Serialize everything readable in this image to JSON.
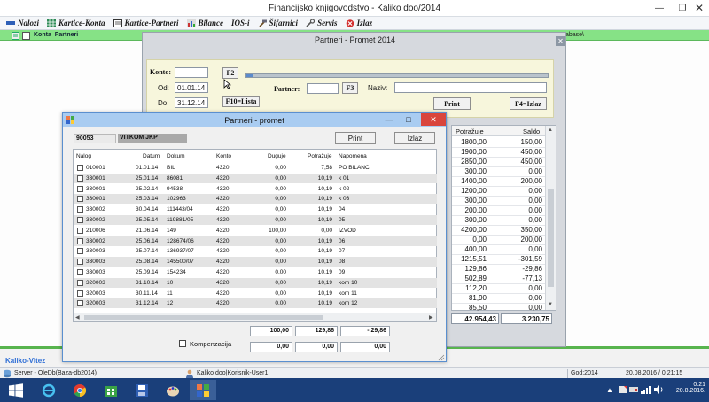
{
  "window": {
    "title": "Financijsko knjigovodstvo - Kaliko doo/2014"
  },
  "menu": [
    {
      "label": "Nalozi",
      "icon": "document-icon"
    },
    {
      "label": "Kartice-Konta",
      "icon": "grid-icon"
    },
    {
      "label": "Kartice-Partneri",
      "icon": "card-icon"
    },
    {
      "label": "Bilance",
      "icon": "chart-icon"
    },
    {
      "label": "IOS-i",
      "icon": ""
    },
    {
      "label": "Šifarnici",
      "icon": "hammer-icon"
    },
    {
      "label": "Servis",
      "icon": "wrench-icon"
    },
    {
      "label": "Izlaz",
      "icon": "exit-icon"
    }
  ],
  "tabs": {
    "konta": "Konta",
    "partneri": "Partneri"
  },
  "green_right": "tabase\\",
  "partneri_promet_window": {
    "title": "Partneri - Promet 2014",
    "konto_label": "Konto:",
    "konto_value": "",
    "f2_button": "F2",
    "od_label": "Od:",
    "od_value": "01.01.14",
    "do_label": "Do:",
    "do_value": "31.12.14",
    "f10_button": "F10=Lista",
    "partner_label": "Partner:",
    "partner_value": "",
    "f3_button": "F3",
    "naziv_label": "Naziv:",
    "naziv_value": "",
    "print_button": "Print",
    "f4_button": "F4=Izlaz",
    "progress": 0.02,
    "columns": {
      "potrazuje": "Potražuje",
      "saldo": "Saldo"
    },
    "rows": [
      {
        "potrazuje": "1800,00",
        "saldo": "150,00"
      },
      {
        "potrazuje": "1900,00",
        "saldo": "450,00"
      },
      {
        "potrazuje": "2850,00",
        "saldo": "450,00"
      },
      {
        "potrazuje": "300,00",
        "saldo": "0,00"
      },
      {
        "potrazuje": "1400,00",
        "saldo": "200,00"
      },
      {
        "potrazuje": "1200,00",
        "saldo": "0,00"
      },
      {
        "potrazuje": "300,00",
        "saldo": "0,00"
      },
      {
        "potrazuje": "200,00",
        "saldo": "0,00"
      },
      {
        "potrazuje": "300,00",
        "saldo": "0,00"
      },
      {
        "potrazuje": "4200,00",
        "saldo": "350,00"
      },
      {
        "potrazuje": "0,00",
        "saldo": "200,00"
      },
      {
        "potrazuje": "400,00",
        "saldo": "0,00"
      },
      {
        "potrazuje": "1215,51",
        "saldo": "-301,59"
      },
      {
        "potrazuje": "129,86",
        "saldo": "-29,86"
      },
      {
        "potrazuje": "502,89",
        "saldo": "-77,13"
      },
      {
        "potrazuje": "112,20",
        "saldo": "0,00"
      },
      {
        "potrazuje": "81,90",
        "saldo": "0,00"
      },
      {
        "potrazuje": "85,50",
        "saldo": "0,00"
      }
    ],
    "total_potrazuje": "42.954,43",
    "total_saldo": "3.230,75"
  },
  "dialog": {
    "title": "Partneri - promet",
    "partner_code": "90053",
    "partner_name": "VITKOM JKP",
    "print_button": "Print",
    "izlaz_button": "Izlaz",
    "columns": {
      "nalog": "Nalog",
      "datum": "Datum",
      "dokum": "Dokum",
      "konto": "Konto",
      "duguje": "Duguje",
      "potrazuje": "Potražuje",
      "napomena": "Napomena"
    },
    "rows": [
      {
        "nalog": "010001",
        "datum": "01.01.14",
        "dokum": "BIL",
        "konto": "4320",
        "duguje": "0,00",
        "potrazuje": "7,58",
        "napomena": "PO BILANCI"
      },
      {
        "nalog": "330001",
        "datum": "25.01.14",
        "dokum": "86081",
        "konto": "4320",
        "duguje": "0,00",
        "potrazuje": "10,19",
        "napomena": "k 01"
      },
      {
        "nalog": "330001",
        "datum": "25.02.14",
        "dokum": "94538",
        "konto": "4320",
        "duguje": "0,00",
        "potrazuje": "10,19",
        "napomena": "k 02"
      },
      {
        "nalog": "330001",
        "datum": "25.03.14",
        "dokum": "102963",
        "konto": "4320",
        "duguje": "0,00",
        "potrazuje": "10,19",
        "napomena": "k 03"
      },
      {
        "nalog": "330002",
        "datum": "30.04.14",
        "dokum": "111443/04",
        "konto": "4320",
        "duguje": "0,00",
        "potrazuje": "10,19",
        "napomena": "04"
      },
      {
        "nalog": "330002",
        "datum": "25.05.14",
        "dokum": "119881/05",
        "konto": "4320",
        "duguje": "0,00",
        "potrazuje": "10,19",
        "napomena": "05"
      },
      {
        "nalog": "210006",
        "datum": "21.06.14",
        "dokum": "149",
        "konto": "4320",
        "duguje": "100,00",
        "potrazuje": "0,00",
        "napomena": "IZVOD"
      },
      {
        "nalog": "330002",
        "datum": "25.06.14",
        "dokum": "128674/06",
        "konto": "4320",
        "duguje": "0,00",
        "potrazuje": "10,19",
        "napomena": "06"
      },
      {
        "nalog": "330003",
        "datum": "25.07.14",
        "dokum": "136937/07",
        "konto": "4320",
        "duguje": "0,00",
        "potrazuje": "10,19",
        "napomena": "07"
      },
      {
        "nalog": "330003",
        "datum": "25.08.14",
        "dokum": "145500/07",
        "konto": "4320",
        "duguje": "0,00",
        "potrazuje": "10,19",
        "napomena": "08"
      },
      {
        "nalog": "330003",
        "datum": "25.09.14",
        "dokum": "154234",
        "konto": "4320",
        "duguje": "0,00",
        "potrazuje": "10,19",
        "napomena": "09"
      },
      {
        "nalog": "320003",
        "datum": "31.10.14",
        "dokum": "10",
        "konto": "4320",
        "duguje": "0,00",
        "potrazuje": "10,19",
        "napomena": "kom 10"
      },
      {
        "nalog": "320003",
        "datum": "30.11.14",
        "dokum": "11",
        "konto": "4320",
        "duguje": "0,00",
        "potrazuje": "10,19",
        "napomena": "kom 11"
      },
      {
        "nalog": "320003",
        "datum": "31.12.14",
        "dokum": "12",
        "konto": "4320",
        "duguje": "0,00",
        "potrazuje": "10,19",
        "napomena": "kom 12"
      }
    ],
    "total_duguje": "100,00",
    "total_potrazuje": "129,86",
    "total_saldo": "- 29,86",
    "kompenzacija_label": "Kompenzacija",
    "komp_duguje": "0,00",
    "komp_potrazuje": "0,00",
    "komp_saldo": "0,00"
  },
  "logo_text": "Kaliko-Vitez",
  "statusbar": {
    "server": "Server - OleDb(Baza-db2014)",
    "user": "Kaliko doo|Korisnik-User1",
    "godina": "God:2014",
    "datetime": "20.08.2016 / 0:21:15"
  },
  "taskbar": {
    "time": "0:21",
    "date": "20.8.2016."
  },
  "colors": {
    "accent_green": "#86e286",
    "dialog_title": "#a9ccf1",
    "close_red": "#d9453c",
    "taskbar": "#1a3f7a"
  }
}
